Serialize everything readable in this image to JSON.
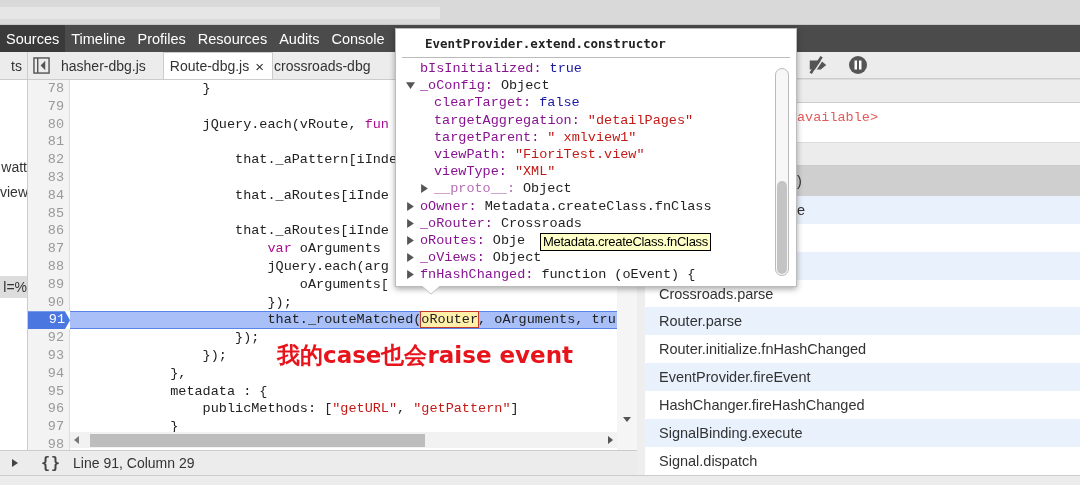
{
  "panel_tabs": [
    {
      "label": "Sources",
      "selected": true
    },
    {
      "label": "Timeline",
      "selected": false
    },
    {
      "label": "Profiles",
      "selected": false
    },
    {
      "label": "Resources",
      "selected": false
    },
    {
      "label": "Audits",
      "selected": false
    },
    {
      "label": "Console",
      "selected": false
    }
  ],
  "navigator": {
    "tab": "ts",
    "items": [
      {
        "text": "watt",
        "selected": false
      },
      {
        "text": "view",
        "selected": false
      },
      {
        "text": "l=%",
        "selected": true
      }
    ]
  },
  "file_tabs": [
    {
      "label": "hasher-dbg.js",
      "selected": false
    },
    {
      "label": "Route-dbg.js",
      "selected": true,
      "close": "×"
    },
    {
      "label": "crossroads-dbg",
      "selected": false
    }
  ],
  "editor": {
    "lines": [
      {
        "number": "78",
        "current": false,
        "tokens": [
          {
            "text": "                }",
            "kind": "plain"
          }
        ]
      },
      {
        "number": "79",
        "current": false
      },
      {
        "number": "80",
        "current": false,
        "tokens": [
          {
            "text": "                jQuery.each(vRoute, ",
            "kind": "plain"
          },
          {
            "text": "fun",
            "kind": "keyword"
          }
        ]
      },
      {
        "number": "81",
        "current": false
      },
      {
        "number": "82",
        "current": false,
        "tokens": [
          {
            "text": "                    that._aPattern[iInde",
            "kind": "plain"
          }
        ]
      },
      {
        "number": "83",
        "current": false
      },
      {
        "number": "84",
        "current": false,
        "tokens": [
          {
            "text": "                    that._aRoutes[iInde",
            "kind": "plain"
          }
        ]
      },
      {
        "number": "85",
        "current": false
      },
      {
        "number": "86",
        "current": false,
        "tokens": [
          {
            "text": "                    that._aRoutes[iInde",
            "kind": "plain"
          }
        ]
      },
      {
        "number": "87",
        "current": false,
        "tokens": [
          {
            "text": "                        var",
            "kind": "keyword"
          },
          {
            "text": " oArguments",
            "kind": "plain"
          }
        ]
      },
      {
        "number": "88",
        "current": false,
        "tokens": [
          {
            "text": "                        jQuery.each(arg",
            "kind": "plain"
          }
        ]
      },
      {
        "number": "89",
        "current": false,
        "tokens": [
          {
            "text": "                            oArguments[",
            "kind": "plain"
          }
        ]
      },
      {
        "number": "90",
        "current": false,
        "tokens": [
          {
            "text": "                        });",
            "kind": "plain"
          }
        ]
      },
      {
        "number": "91",
        "current": true,
        "tokens": [
          {
            "text": "                        that._routeMatched(",
            "kind": "plain"
          },
          {
            "text": "oRouter",
            "kind": "highlight"
          },
          {
            "text": ", oArguments, tru",
            "kind": "plain"
          }
        ]
      },
      {
        "number": "92",
        "current": false,
        "tokens": [
          {
            "text": "                    });",
            "kind": "plain"
          }
        ]
      },
      {
        "number": "93",
        "current": false,
        "tokens": [
          {
            "text": "                });",
            "kind": "plain"
          }
        ]
      },
      {
        "number": "94",
        "current": false,
        "tokens": [
          {
            "text": "            },",
            "kind": "plain"
          }
        ]
      },
      {
        "number": "95",
        "current": false,
        "tokens": [
          {
            "text": "            metadata : {",
            "kind": "plain"
          }
        ]
      },
      {
        "number": "96",
        "current": false,
        "tokens": [
          {
            "text": "                publicMethods: [",
            "kind": "plain"
          },
          {
            "text": "\"getURL\"",
            "kind": "string"
          },
          {
            "text": ", ",
            "kind": "plain"
          },
          {
            "text": "\"getPattern\"",
            "kind": "string"
          },
          {
            "text": "]",
            "kind": "plain"
          }
        ]
      },
      {
        "number": "97",
        "current": false,
        "tokens": [
          {
            "text": "            }",
            "kind": "plain"
          }
        ]
      },
      {
        "number": "98",
        "current": false
      }
    ]
  },
  "annotation": "我的case也会raise event",
  "status_bar": {
    "pretty_print": "{}",
    "position": "Line 91, Column 29"
  },
  "popover": {
    "title": "EventProvider.extend.constructor",
    "properties": [
      {
        "name": "bIsInitialized:",
        "value": {
          "text": "true",
          "kind": "literal"
        },
        "kind": "leaf",
        "dimmed": false
      },
      {
        "name": "_oConfig:",
        "value": {
          "text": "Object",
          "kind": "object"
        },
        "kind": "object",
        "expanded": true,
        "dimmed": false,
        "children": [
          {
            "name": "clearTarget:",
            "value": {
              "text": "false",
              "kind": "literal"
            },
            "kind": "leaf",
            "dimmed": false
          },
          {
            "name": "targetAggregation:",
            "value": {
              "text": "\"detailPages\"",
              "kind": "string"
            },
            "kind": "leaf",
            "dimmed": false
          },
          {
            "name": "targetParent:",
            "value": {
              "text": "\"  xmlview1\"",
              "kind": "string"
            },
            "kind": "leaf",
            "dimmed": false
          },
          {
            "name": "viewPath:",
            "value": {
              "text": "\"FioriTest.view\"",
              "kind": "string"
            },
            "kind": "leaf",
            "dimmed": false
          },
          {
            "name": "viewType:",
            "value": {
              "text": "\"XML\"",
              "kind": "string"
            },
            "kind": "leaf",
            "dimmed": false
          },
          {
            "name": "__proto__:",
            "value": {
              "text": "Object",
              "kind": "object"
            },
            "kind": "object",
            "expanded": false,
            "dimmed": true
          }
        ]
      },
      {
        "name": "oOwner:",
        "value": {
          "text": "Metadata.createClass.fnClass",
          "kind": "object"
        },
        "kind": "object",
        "expanded": false,
        "dimmed": false
      },
      {
        "name": "_oRouter:",
        "value": {
          "text": "Crossroads",
          "kind": "object"
        },
        "kind": "object",
        "expanded": false,
        "dimmed": false
      },
      {
        "name": "oRoutes:",
        "value": {
          "text": "Obje",
          "kind": "object"
        },
        "kind": "object",
        "expanded": false,
        "dimmed": false
      },
      {
        "name": "_oViews:",
        "value": {
          "text": "Object",
          "kind": "object"
        },
        "kind": "object",
        "expanded": false,
        "dimmed": false
      },
      {
        "name": "fnHashChanged:",
        "value": {
          "text": "function (oEvent) {",
          "kind": "object"
        },
        "kind": "object",
        "expanded": false,
        "dimmed": false
      }
    ]
  },
  "tooltip": "Metadata.createClass.fnClass",
  "scope": {
    "text": "available>"
  },
  "call_stack": [
    {
      "name": ")",
      "selected": true,
      "kind": "clipped"
    },
    {
      "name": "e",
      "selected": false,
      "kind": "clipped"
    },
    {
      "selected": false,
      "kind": "clipped"
    },
    {
      "selected": false,
      "kind": "clipped"
    },
    {
      "name": "Crossroads.parse",
      "selected": false,
      "kind": "full"
    },
    {
      "name": "Router.parse",
      "selected": false,
      "kind": "full"
    },
    {
      "name": "Router.initialize.fnHashChanged",
      "selected": false,
      "kind": "full"
    },
    {
      "name": "EventProvider.fireEvent",
      "selected": false,
      "kind": "full"
    },
    {
      "name": "HashChanger.fireHashChanged",
      "selected": false,
      "kind": "full"
    },
    {
      "name": "SignalBinding.execute",
      "selected": false,
      "kind": "full"
    },
    {
      "name": "Signal.dispatch",
      "selected": false,
      "kind": "full"
    }
  ]
}
